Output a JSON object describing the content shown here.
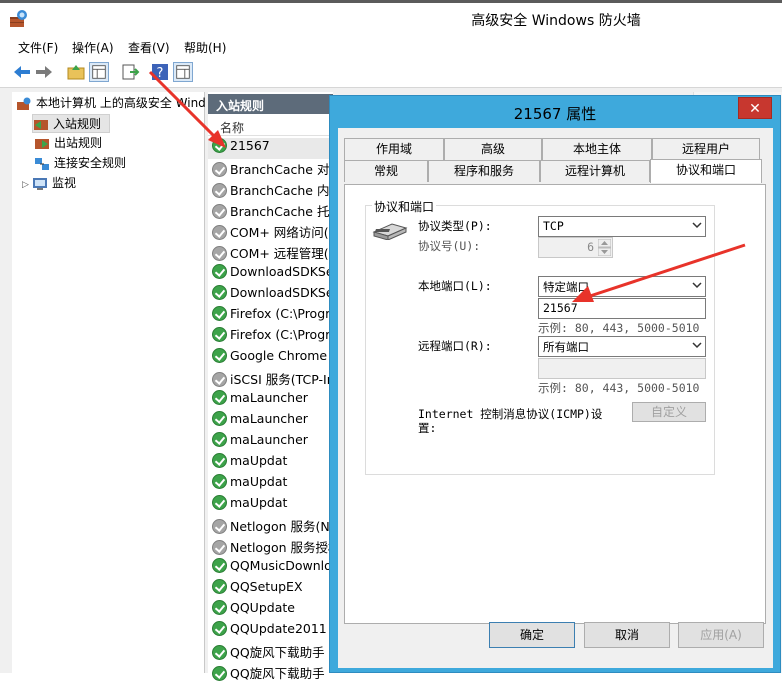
{
  "window": {
    "title": "高级安全 Windows 防火墙"
  },
  "menu": {
    "items": [
      "文件(F)",
      "操作(A)",
      "查看(V)",
      "帮助(H)"
    ]
  },
  "tree": {
    "root": "本地计算机 上的高级安全 Wind",
    "inbound": "入站规则",
    "outbound": "出站规则",
    "connection_security": "连接安全规则",
    "monitor": "监视"
  },
  "list": {
    "header": "入站规则",
    "column_name": "名称",
    "rules": [
      {
        "name": "21567",
        "enabled": true
      },
      {
        "name": "BranchCache 对等",
        "enabled": false
      },
      {
        "name": "BranchCache 内容",
        "enabled": false
      },
      {
        "name": "BranchCache 托管",
        "enabled": false
      },
      {
        "name": "COM+ 网络访问(D",
        "enabled": false
      },
      {
        "name": "COM+ 远程管理(D",
        "enabled": false
      },
      {
        "name": "DownloadSDKSer",
        "enabled": true
      },
      {
        "name": "DownloadSDKSer",
        "enabled": true
      },
      {
        "name": "Firefox (C:\\Progra",
        "enabled": true
      },
      {
        "name": "Firefox (C:\\Progra",
        "enabled": true
      },
      {
        "name": "Google Chrome",
        "enabled": true
      },
      {
        "name": "iSCSI 服务(TCP-In",
        "enabled": false
      },
      {
        "name": "maLauncher",
        "enabled": true
      },
      {
        "name": "maLauncher",
        "enabled": true
      },
      {
        "name": "maLauncher",
        "enabled": true
      },
      {
        "name": "maUpdat",
        "enabled": true
      },
      {
        "name": "maUpdat",
        "enabled": true
      },
      {
        "name": "maUpdat",
        "enabled": true
      },
      {
        "name": "Netlogon 服务(N",
        "enabled": false
      },
      {
        "name": "Netlogon 服务授权",
        "enabled": false
      },
      {
        "name": "QQMusicDownlo",
        "enabled": true
      },
      {
        "name": "QQSetupEX",
        "enabled": true
      },
      {
        "name": "QQUpdate",
        "enabled": true
      },
      {
        "name": "QQUpdate2011",
        "enabled": true
      },
      {
        "name": "QQ旋风下载助手",
        "enabled": true
      },
      {
        "name": "QQ旋风下载助手",
        "enabled": true
      }
    ]
  },
  "dialog": {
    "title": "21567 属性",
    "close": "✕",
    "tabs_row1": [
      "作用域",
      "高级",
      "本地主体",
      "远程用户"
    ],
    "tabs_row2": [
      "常规",
      "程序和服务",
      "远程计算机",
      "协议和端口"
    ],
    "group_title": "协议和端口",
    "protocol_type_label": "协议类型(P):",
    "protocol_type_value": "TCP",
    "protocol_number_label": "协议号(U):",
    "protocol_number_value": "6",
    "local_port_label": "本地端口(L):",
    "local_port_mode": "特定端口",
    "local_port_value": "21567",
    "local_example": "示例: 80, 443, 5000-5010",
    "remote_port_label": "远程端口(R):",
    "remote_port_mode": "所有端口",
    "remote_port_value": "",
    "remote_example": "示例: 80, 443, 5000-5010",
    "icmp_label_line1": "Internet 控制消息协议(ICMP)设",
    "icmp_label_line2": "置:",
    "customize_button": "自定义",
    "ok_button": "确定",
    "cancel_button": "取消",
    "apply_button": "应用(A)"
  },
  "colors": {
    "dialog_frame": "#3ea9dc",
    "annotation_arrow": "#e8332a",
    "enabled_rule": "#3da34a"
  }
}
